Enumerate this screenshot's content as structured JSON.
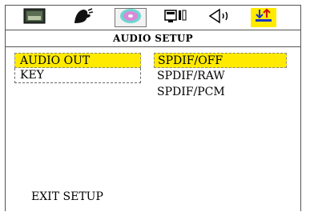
{
  "header": {
    "title": "AUDIO SETUP",
    "tabs": [
      {
        "name": "tab-general",
        "icon": "monitor-icon"
      },
      {
        "name": "tab-video",
        "icon": "face-icon"
      },
      {
        "name": "tab-disc",
        "icon": "disc-icon",
        "active": true
      },
      {
        "name": "tab-speaker-setup",
        "icon": "speaker-box-icon"
      },
      {
        "name": "tab-audio",
        "icon": "speaker-icon"
      },
      {
        "name": "tab-preference",
        "icon": "updown-arrows-icon",
        "highlight": true
      }
    ]
  },
  "menu": {
    "items": [
      {
        "label": "AUDIO OUT"
      },
      {
        "label": "KEY"
      }
    ]
  },
  "options": {
    "items": [
      {
        "label": "SPDIF/OFF"
      },
      {
        "label": "SPDIF/RAW"
      },
      {
        "label": "SPDIF/PCM"
      }
    ]
  },
  "footer": {
    "exit_label": "EXIT SETUP"
  },
  "colors": {
    "highlight": "#ffea00",
    "border": "#555555"
  }
}
